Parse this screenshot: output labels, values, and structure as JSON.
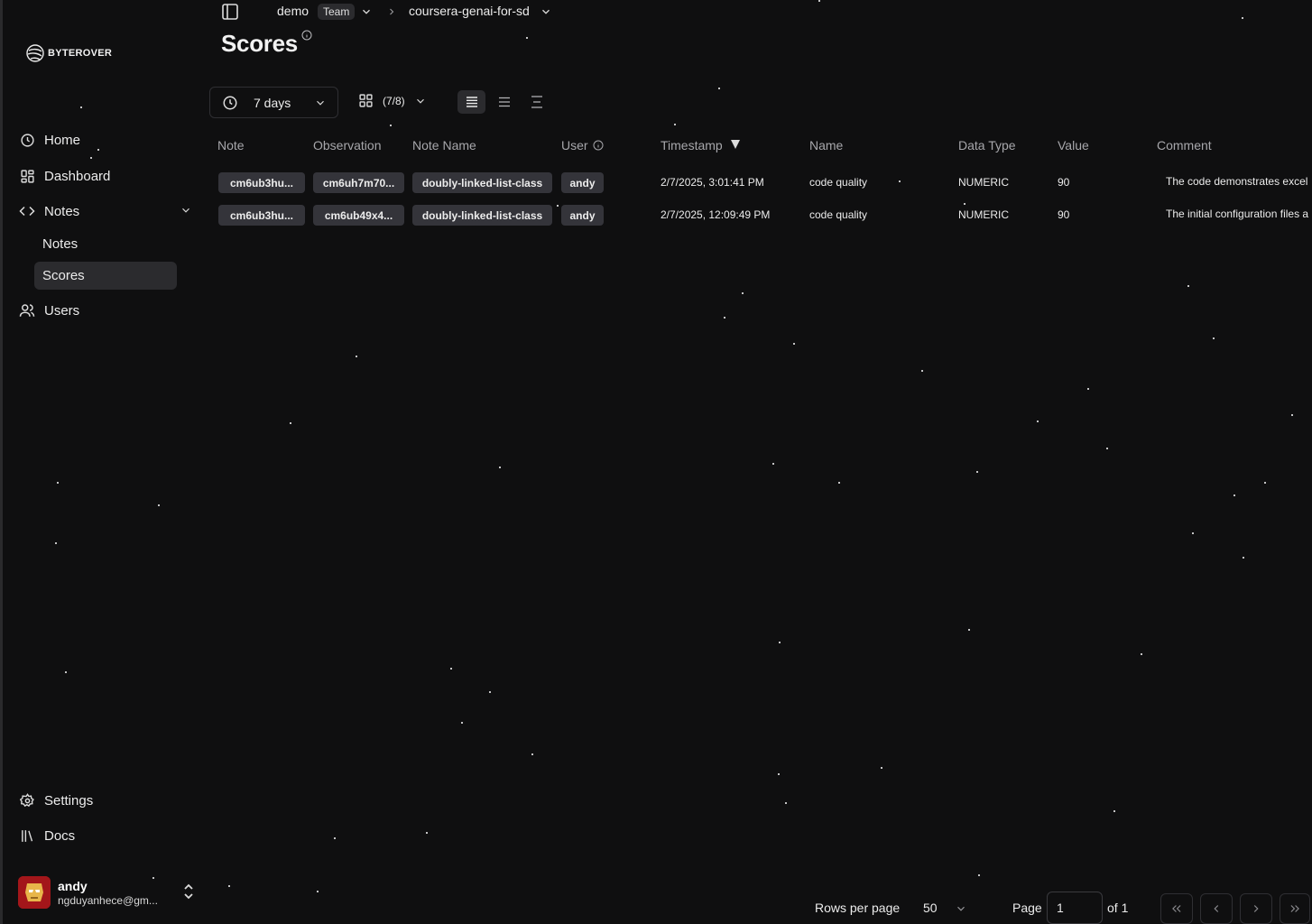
{
  "brand": {
    "name": "BYTEROVER"
  },
  "breadcrumb": {
    "org": "demo",
    "org_badge": "Team",
    "project": "coursera-genai-for-sd"
  },
  "page": {
    "title": "Scores"
  },
  "sidebar": {
    "items": [
      {
        "label": "Home",
        "icon": "clock-icon"
      },
      {
        "label": "Dashboard",
        "icon": "grid-icon"
      },
      {
        "label": "Notes",
        "icon": "code-icon"
      },
      {
        "label": "Users",
        "icon": "users-icon"
      }
    ],
    "subitems": [
      {
        "label": "Notes"
      },
      {
        "label": "Scores"
      }
    ],
    "bottom": [
      {
        "label": "Settings",
        "icon": "gear-icon"
      },
      {
        "label": "Docs",
        "icon": "library-icon"
      }
    ],
    "user": {
      "name": "andy",
      "email": "ngduyanhece@gm..."
    }
  },
  "toolbar": {
    "time_range": "7 days",
    "columns": "(7/8)"
  },
  "table": {
    "headers": [
      "Note",
      "Observation",
      "Note Name",
      "User",
      "Timestamp",
      "Name",
      "Data Type",
      "Value",
      "Comment"
    ],
    "rows": [
      {
        "note": "cm6ub3hu...",
        "observation": "cm6uh7m70...",
        "note_name": "doubly-linked-list-class",
        "user": "andy",
        "timestamp": "2/7/2025, 3:01:41 PM",
        "name": "code quality",
        "data_type": "NUMERIC",
        "value": "90",
        "comment": "The code demonstrates excel"
      },
      {
        "note": "cm6ub3hu...",
        "observation": "cm6ub49x4...",
        "note_name": "doubly-linked-list-class",
        "user": "andy",
        "timestamp": "2/7/2025, 12:09:49 PM",
        "name": "code quality",
        "data_type": "NUMERIC",
        "value": "90",
        "comment": "The initial configuration files a"
      }
    ]
  },
  "pagination": {
    "rows_per_page_label": "Rows per page",
    "rows_per_page": "50",
    "page_label": "Page",
    "page_value": "1",
    "of_label": "of 1"
  }
}
